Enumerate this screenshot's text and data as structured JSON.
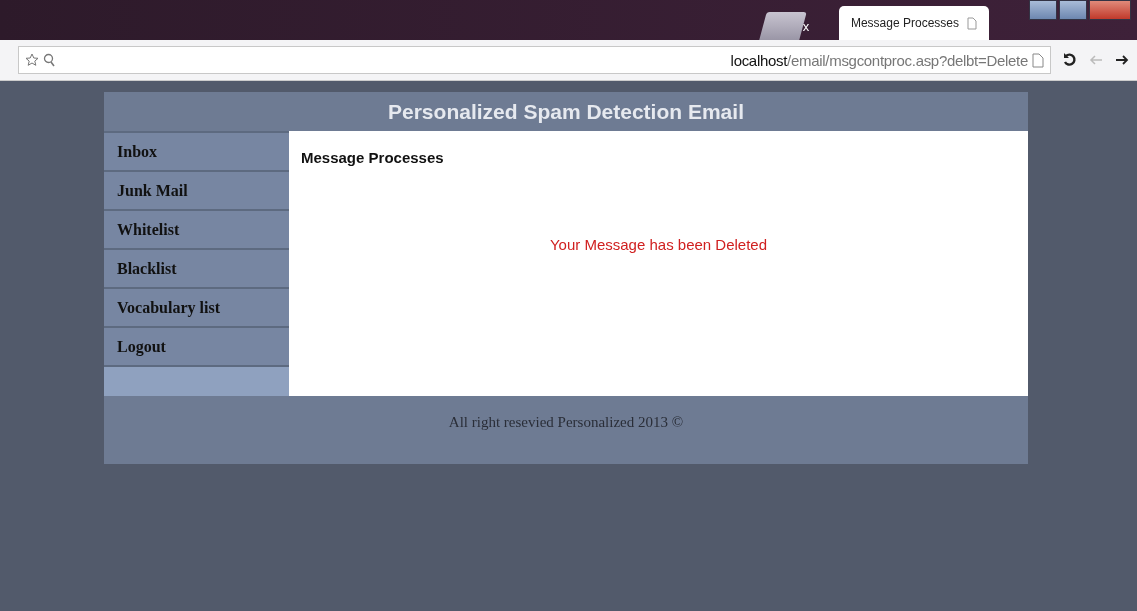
{
  "browser": {
    "tabs": [
      {
        "close": "x",
        "selected": false
      },
      {
        "label": "Message Processes",
        "selected": true
      }
    ],
    "address": {
      "host": "localhost",
      "path": "/email/msgcontproc.asp?delbt=Delete"
    }
  },
  "page": {
    "title": "Personalized Spam Detection Email",
    "menu": [
      "Inbox",
      "Junk Mail",
      "Whitelist",
      "Blacklist",
      "Vocabulary list",
      "Logout"
    ],
    "heading": "Message Processes",
    "message": "Your Message has been Deleted",
    "footer": "All right resevied Personalized 2013 ©"
  }
}
